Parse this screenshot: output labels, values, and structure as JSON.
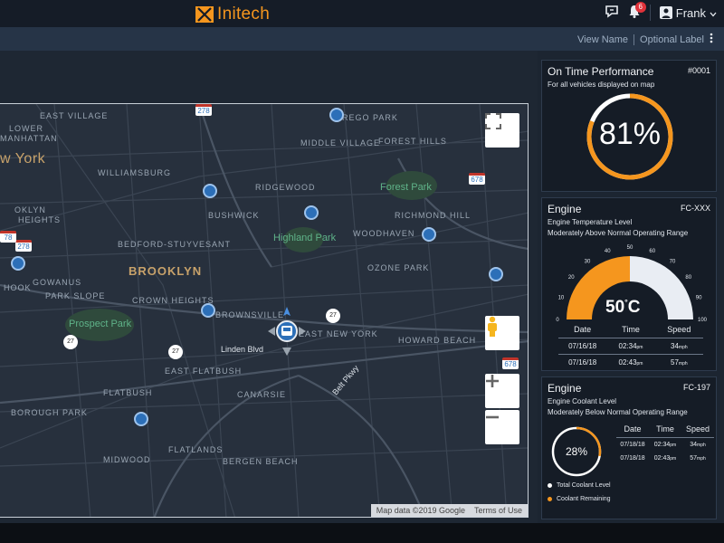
{
  "header": {
    "brand": "Initech",
    "notification_count": "6",
    "user_name": "Frank"
  },
  "subbar": {
    "view_name": "View Name",
    "optional_label": "Optional Label"
  },
  "map": {
    "labels": {
      "east_village": "EAST VILLAGE",
      "lower": "LOWER",
      "manhattan": "MANHATTAN",
      "new_york": "w York",
      "williamsburg": "WILLIAMSBURG",
      "ridgewood": "RIDGEWOOD",
      "rego_park": "REGO PARK",
      "middle_village": "MIDDLE VILLAGE",
      "forest_hills": "FOREST HILLS",
      "forest_park": "Forest Park",
      "richmond_hill": "RICHMOND HILL",
      "bushwick": "BUSHWICK",
      "brooklyn_heights_1": "OKLYN",
      "brooklyn_heights_2": "HEIGHTS",
      "highland_park": "Highland Park",
      "woodhaven": "WOODHAVEN",
      "bed_stuy": "BEDFORD-STUYVESANT",
      "ozone_park": "OZONE PARK",
      "brooklyn": "BROOKLYN",
      "gowanus": "GOWANUS",
      "hook": "HOOK",
      "park_slope": "PARK SLOPE",
      "crown_heights": "CROWN HEIGHTS",
      "brownsville": "BROWNSVILLE",
      "prospect_park": "Prospect Park",
      "east_new_york": "EAST NEW YORK",
      "howard_beach": "HOWARD BEACH",
      "linden_blvd": "Linden Blvd",
      "east_flatbush": "EAST FLATBUSH",
      "belt_pkwy": "Belt Pkwy",
      "flatbush": "FLATBUSH",
      "canarsie": "CANARSIE",
      "borough_park": "BOROUGH PARK",
      "flatlands": "FLATLANDS",
      "midwood": "MIDWOOD",
      "bergen_beach": "BERGEN BEACH"
    },
    "shields": {
      "i278_a": "278",
      "i278_b": "278",
      "i678_a": "678",
      "i678_b": "678",
      "r27_a": "27",
      "r27_b": "27",
      "r27_c": "27",
      "r27_d": "27",
      "i78": "78"
    },
    "attribution": "Map data ©2019 Google",
    "terms": "Terms of Use"
  },
  "on_time": {
    "title": "On Time Performance",
    "code": "#0001",
    "subtitle": "For all vehicles displayed on map",
    "value_text": "81%",
    "percent": 81
  },
  "engine_temp": {
    "title": "Engine",
    "code": "FC-XXX",
    "subtitle1": "Engine Temperature Level",
    "subtitle2": "Moderately Above Normal Operating Range",
    "value_text": "50",
    "unit": "C",
    "value": 50,
    "scale_max": 100,
    "ticks": [
      "0",
      "10",
      "20",
      "30",
      "40",
      "50",
      "60",
      "70",
      "80",
      "90",
      "100"
    ],
    "table": {
      "headers": [
        "Date",
        "Time",
        "Speed"
      ],
      "rows": [
        {
          "date": "07/16/18",
          "time": "02:34",
          "time_suffix": "pm",
          "speed": "34",
          "speed_unit": "mph"
        },
        {
          "date": "07/16/18",
          "time": "02:43",
          "time_suffix": "pm",
          "speed": "57",
          "speed_unit": "mph"
        }
      ]
    }
  },
  "engine_coolant": {
    "title": "Engine",
    "code": "FC-197",
    "subtitle1": "Engine Coolant Level",
    "subtitle2": "Moderately Below Normal Operating Range",
    "value_text": "28%",
    "percent": 28,
    "table": {
      "headers": [
        "Date",
        "Time",
        "Speed"
      ],
      "rows": [
        {
          "date": "07/18/18",
          "time": "02:34",
          "time_suffix": "pm",
          "speed": "34",
          "speed_unit": "mph"
        },
        {
          "date": "07/18/18",
          "time": "02:43",
          "time_suffix": "pm",
          "speed": "57",
          "speed_unit": "mph"
        }
      ]
    },
    "legend": {
      "total": "Total Coolant Level",
      "remaining": "Coolant Remaining"
    }
  },
  "colors": {
    "accent": "#f5961e",
    "ring_track": "#ffffff",
    "gauge_track": "#e9edf3"
  }
}
